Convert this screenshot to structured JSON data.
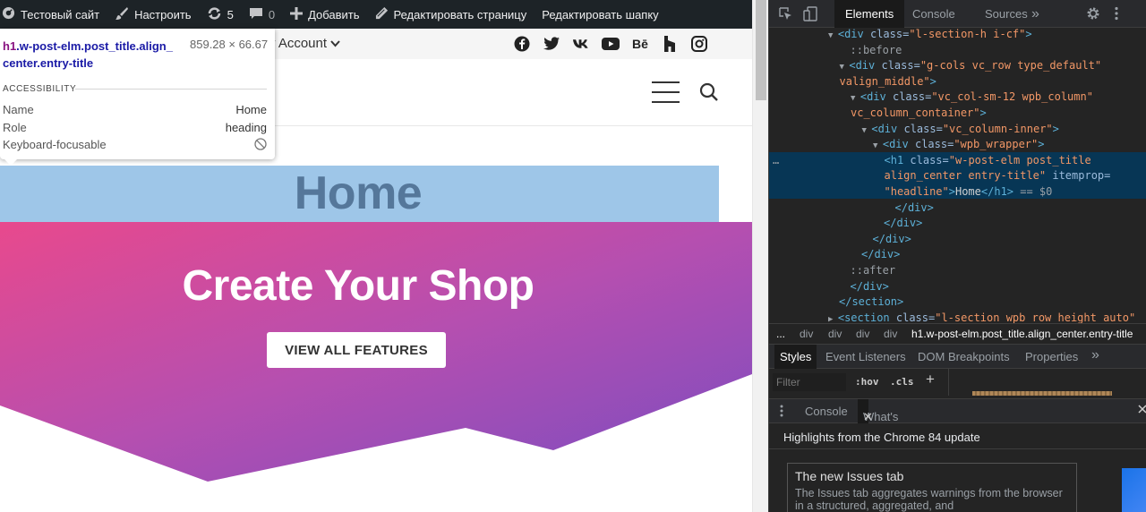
{
  "wp_admin_bar": {
    "site_name": "Тестовый сайт",
    "customize": "Настроить",
    "updates_count": "5",
    "comments_count": "0",
    "add_new": "Добавить",
    "edit_page": "Редактировать страницу",
    "edit_header": "Редактировать шапку"
  },
  "site": {
    "account_menu": "y Account",
    "page_title": "Home",
    "hero_title": "Create Your Shop",
    "hero_button": "VIEW ALL FEATURES",
    "social_icons": [
      "facebook-icon",
      "twitter-icon",
      "vk-icon",
      "youtube-icon",
      "behance-icon",
      "houzz-icon",
      "instagram-icon"
    ],
    "hero_gradient": [
      "#e8498d",
      "#b54fb0",
      "#7a4cc0"
    ],
    "title_band_color": "#9ec6e8",
    "title_text_color": "#55779a"
  },
  "inspect_tooltip": {
    "selector_tag": "h1",
    "selector_line1": ".w-post-elm.post_title.align_",
    "selector_line2": "center.entry-title",
    "dimensions": "859.28 × 66.67",
    "section": "ACCESSIBILITY",
    "rows": [
      {
        "label": "Name",
        "value": "Home"
      },
      {
        "label": "Role",
        "value": "heading"
      },
      {
        "label": "Keyboard-focusable",
        "value": ""
      }
    ]
  },
  "devtools": {
    "tabs": [
      "Elements",
      "Console",
      "Sources"
    ],
    "more": "»",
    "dom_lines": [
      {
        "indent": 0,
        "tri": "▼",
        "tag": "div",
        "attrs": [
          [
            "class",
            "l-section-h i-cf"
          ]
        ],
        "tail": ">"
      },
      {
        "indent": 1,
        "pseudo": "::before"
      },
      {
        "indent": 1,
        "tri": "▼",
        "tag": "div",
        "attrs": [
          [
            "class",
            "g-cols vc_row type_default"
          ]
        ],
        "tail": ""
      },
      {
        "indent": 1,
        "cont": "valign_middle\">"
      },
      {
        "indent": 2,
        "tri": "▼",
        "tag": "div",
        "attrs": [
          [
            "class",
            "vc_col-sm-12 wpb_column"
          ]
        ],
        "tail": ""
      },
      {
        "indent": 2,
        "cont": "vc_column_container\">"
      },
      {
        "indent": 3,
        "tri": "▼",
        "tag": "div",
        "attrs": [
          [
            "class",
            "vc_column-inner"
          ]
        ],
        "tail": ">"
      },
      {
        "indent": 4,
        "tri": "▼",
        "tag": "div",
        "attrs": [
          [
            "class",
            "wpb_wrapper"
          ]
        ],
        "tail": ">"
      },
      {
        "indent": 5,
        "selected": true,
        "line1": "<h1 class=\"w-post-elm post_title",
        "line2": "align_center entry-title\" itemprop=",
        "line3": "\"headline\">Home</h1> == $0"
      },
      {
        "indent": 5,
        "close": "</div>"
      },
      {
        "indent": 4,
        "close": "</div>"
      },
      {
        "indent": 3,
        "close": "</div>"
      },
      {
        "indent": 2,
        "close": "</div>"
      },
      {
        "indent": 1,
        "pseudo": "::after"
      },
      {
        "indent": 1,
        "close": "</div>"
      },
      {
        "indent": 0,
        "close": "</section>"
      },
      {
        "indent": 0,
        "tri": "▶",
        "tag": "section",
        "attrs": [
          [
            "class",
            "l-section wpb_row height_auto"
          ]
        ],
        "tail": ""
      }
    ],
    "h1_line1_tag": "<h1 ",
    "h1_line1_attr": "class=",
    "h1_line1_val": "\"w-post-elm post_title",
    "h1_line2_val": "align_center entry-title\"",
    "h1_line2_attr": " itemprop=",
    "h1_line3_val": "\"headline\"",
    "h1_line3_text": "Home",
    "h1_line3_close": "</h1>",
    "h1_line3_eq": " == $0",
    "breadcrumbs": [
      "...",
      "div",
      "div",
      "div",
      "div",
      "h1.w-post-elm.post_title.align_center.entry-title"
    ],
    "subtabs": [
      "Styles",
      "Event Listeners",
      "DOM Breakpoints",
      "Properties",
      "»"
    ],
    "filter_placeholder": "Filter",
    "hov": ":hov",
    "cls": ".cls",
    "plus": "+",
    "drawer_tabs": [
      "Console",
      "What's New"
    ],
    "whats_new_heading": "Highlights from the Chrome 84 update",
    "card_title": "The new Issues tab",
    "card_desc": "The Issues tab aggregates warnings from the browser in a structured, aggregated, and"
  }
}
